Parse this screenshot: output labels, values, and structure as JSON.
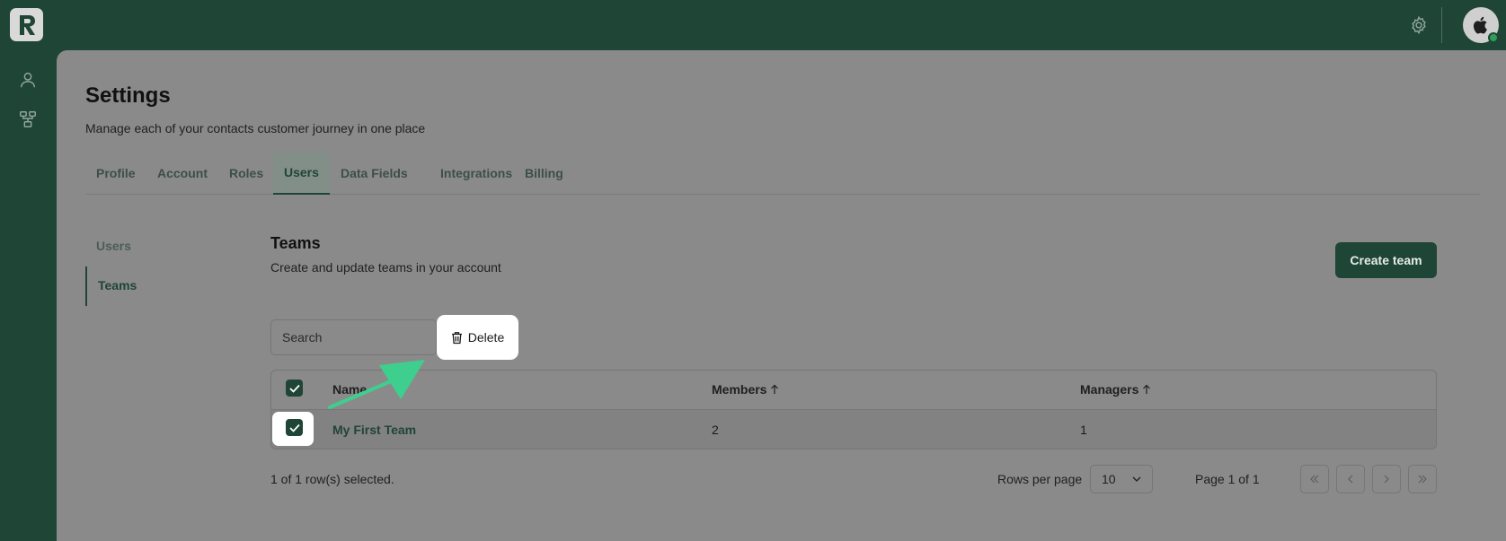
{
  "app": {
    "logo_letter": "R"
  },
  "header": {
    "settings_icon": "gear-icon",
    "avatar_icon": "apple-icon"
  },
  "rail": [
    {
      "icon": "user-icon"
    },
    {
      "icon": "org-chart-icon"
    }
  ],
  "page": {
    "title": "Settings",
    "description": "Manage each of your contacts customer journey in one place"
  },
  "tabs": [
    {
      "label": "Profile"
    },
    {
      "label": "Account"
    },
    {
      "label": "Roles"
    },
    {
      "label": "Users",
      "active": true
    },
    {
      "label": "Data Fields"
    },
    {
      "label": "Integrations"
    },
    {
      "label": "Billing"
    }
  ],
  "sidenav": [
    {
      "label": "Users"
    },
    {
      "label": "Teams",
      "active": true
    }
  ],
  "section": {
    "title": "Teams",
    "description": "Create and update teams in your account",
    "create_label": "Create team"
  },
  "toolbar": {
    "search_placeholder": "Search",
    "delete_label": "Delete"
  },
  "table": {
    "headers": {
      "name": "Name",
      "members": "Members",
      "managers": "Managers"
    },
    "rows": [
      {
        "name": "My First Team",
        "members": "2",
        "managers": "1",
        "selected": true
      }
    ]
  },
  "footer": {
    "selection": "1 of 1 row(s) selected.",
    "rows_per_page_label": "Rows per page",
    "rows_per_page_value": "10",
    "page_info": "Page 1 of 1"
  },
  "colors": {
    "brand": "#1f4536",
    "annotation_arrow": "#3ecf8e",
    "overlay_panel": "#8a8a8a"
  }
}
